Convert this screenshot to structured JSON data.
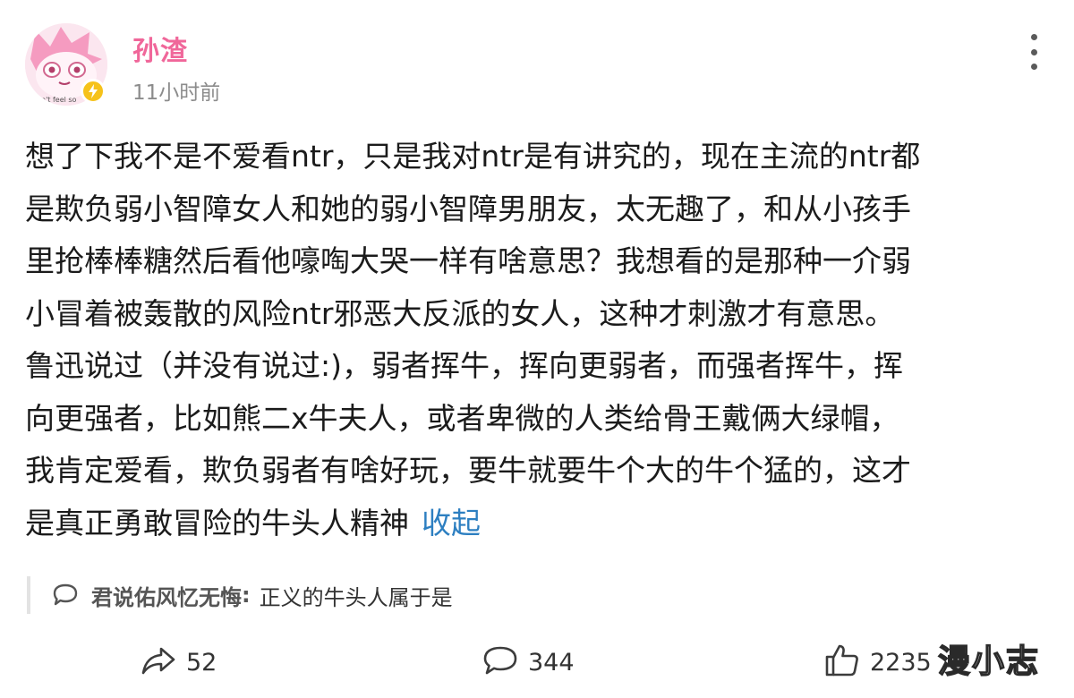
{
  "author": {
    "name": "孙渣",
    "time": "11小时前",
    "avatar_text": "n't feel so"
  },
  "post": {
    "lines": [
      "想了下我不是不爱看ntr，只是我对ntr是有讲究的，现在主流的ntr都",
      "是欺负弱小智障女人和她的弱小智障男朋友，太无趣了，和从小孩手",
      "里抢棒棒糖然后看他嚎啕大哭一样有啥意思？我想看的是那种一介弱",
      "小冒着被轰散的风险ntr邪恶大反派的女人，这种才刺激才有意思。",
      "鲁迅说过（并没有说过:)，弱者挥牛，挥向更弱者，而强者挥牛，挥",
      "向更强者，比如熊二x牛夫人，或者卑微的人类给骨王戴俩大绿帽，",
      "我肯定爱看，欺负弱者有啥好玩，要牛就要牛个大的牛个猛的，这才",
      "是真正勇敢冒险的牛头人精神"
    ],
    "collapse_label": "收起"
  },
  "comment": {
    "user": "君说佑风忆无悔",
    "separator": ":",
    "text": "正义的牛头人属于是"
  },
  "actions": {
    "share_count": "52",
    "reply_count": "344",
    "like_count": "2235"
  },
  "watermark": "漫小志",
  "icons": {
    "more": "more-vertical-icon",
    "verified": "lightning-badge-icon",
    "comment": "speech-bubble-icon",
    "share": "share-arrow-icon",
    "reply": "comment-bubble-icon",
    "like": "thumbs-up-icon"
  },
  "colors": {
    "username": "#f0679a",
    "link": "#2d7fc1",
    "badge": "#f6c21a"
  }
}
